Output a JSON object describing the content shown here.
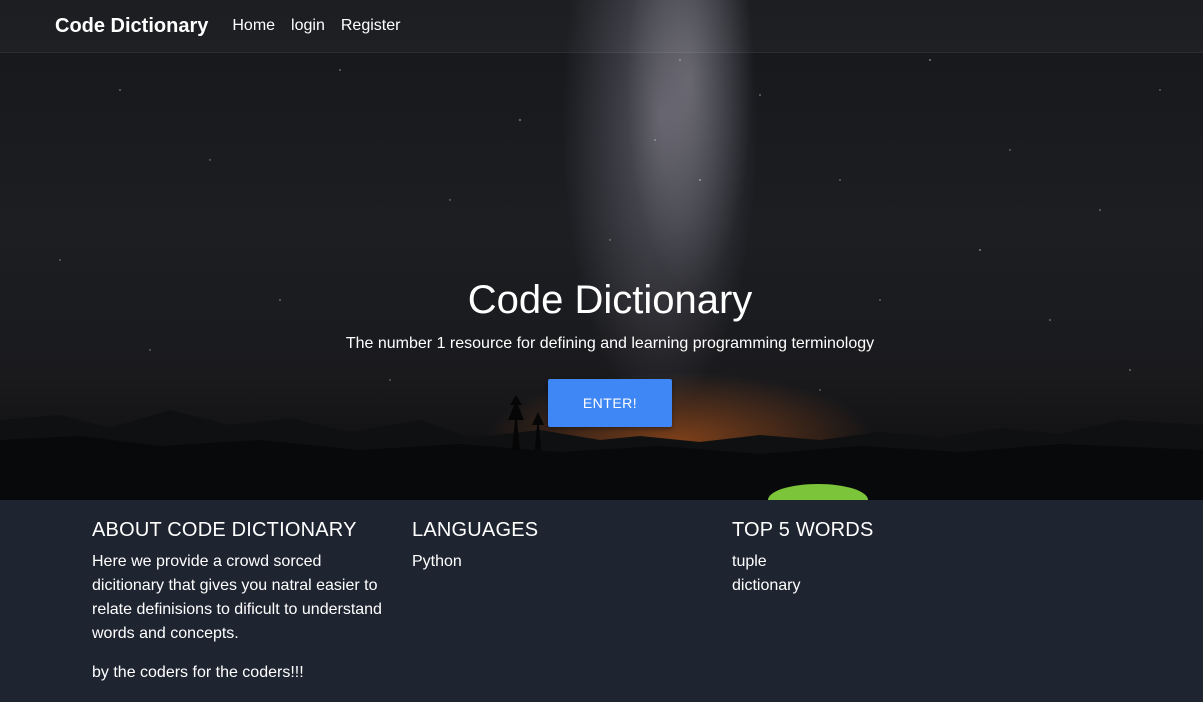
{
  "navbar": {
    "brand": "Code Dictionary",
    "links": [
      "Home",
      "login",
      "Register"
    ]
  },
  "hero": {
    "title": "Code Dictionary",
    "subtitle": "The number 1 resource for defining and learning programming terminology",
    "button_label": "ENTER!"
  },
  "footer": {
    "about": {
      "heading": "ABOUT CODE DICTIONARY",
      "text": "Here we provide a crowd sorced dicitionary that gives you natral easier to relate definisions to dificult to understand words and concepts.",
      "tagline": "by the coders for the coders!!!"
    },
    "languages": {
      "heading": "LANGUAGES",
      "items": [
        "Python"
      ]
    },
    "top_words": {
      "heading": "TOP 5 WORDS",
      "items": [
        "tuple",
        "dictionary"
      ]
    }
  },
  "colors": {
    "button": "#3f87f5",
    "footer_bg": "#1e2430",
    "tent": "#7cc43a"
  }
}
